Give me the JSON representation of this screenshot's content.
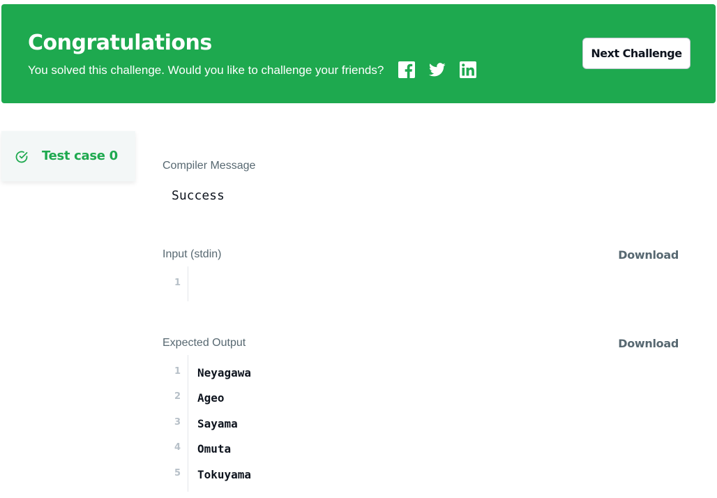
{
  "banner": {
    "title": "Congratulations",
    "subtitle": "You solved this challenge. Would you like to challenge your friends?",
    "share_icons": [
      "facebook-icon",
      "twitter-icon",
      "linkedin-icon"
    ],
    "next_button": "Next Challenge",
    "color": "#1ea94f"
  },
  "testcase": {
    "label": "Test case 0",
    "status_icon": "check-circle-icon",
    "status_color": "#1ea94f"
  },
  "compiler": {
    "label": "Compiler Message",
    "message": "Success"
  },
  "input": {
    "label": "Input (stdin)",
    "download": "Download",
    "lines": [
      {
        "no": "1",
        "text": ""
      }
    ]
  },
  "expected": {
    "label": "Expected Output",
    "download": "Download",
    "lines": [
      {
        "no": "1",
        "text": "Neyagawa"
      },
      {
        "no": "2",
        "text": "Ageo"
      },
      {
        "no": "3",
        "text": "Sayama"
      },
      {
        "no": "4",
        "text": "Omuta"
      },
      {
        "no": "5",
        "text": "Tokuyama"
      }
    ]
  }
}
